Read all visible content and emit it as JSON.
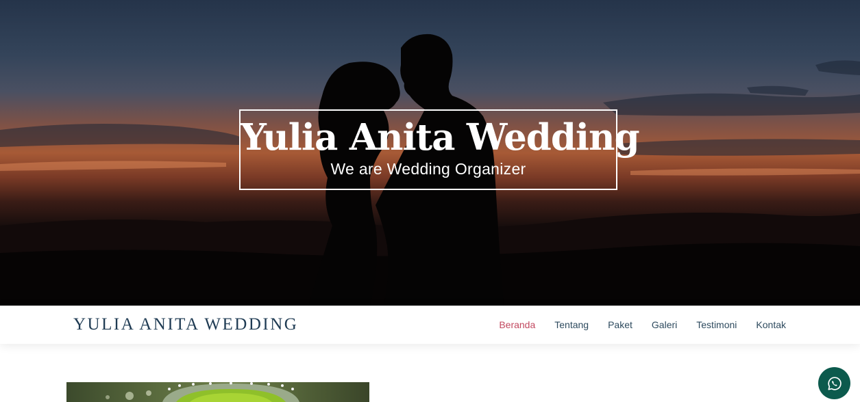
{
  "hero": {
    "title": "Yulia Anita Wedding",
    "subtitle": "We are Wedding Organizer"
  },
  "navbar": {
    "brand": "YULIA ANITA WEDDING",
    "items": [
      {
        "label": "Beranda",
        "active": true
      },
      {
        "label": "Tentang",
        "active": false
      },
      {
        "label": "Paket",
        "active": false
      },
      {
        "label": "Galeri",
        "active": false
      },
      {
        "label": "Testimoni",
        "active": false
      },
      {
        "label": "Kontak",
        "active": false
      }
    ]
  },
  "whatsapp_button": {
    "icon": "whatsapp-icon"
  },
  "colors": {
    "brand_text": "#1f3b53",
    "active_nav": "#c2485f",
    "nav_text": "#2d4a5e",
    "whatsapp_bg": "#0c5a4d"
  }
}
